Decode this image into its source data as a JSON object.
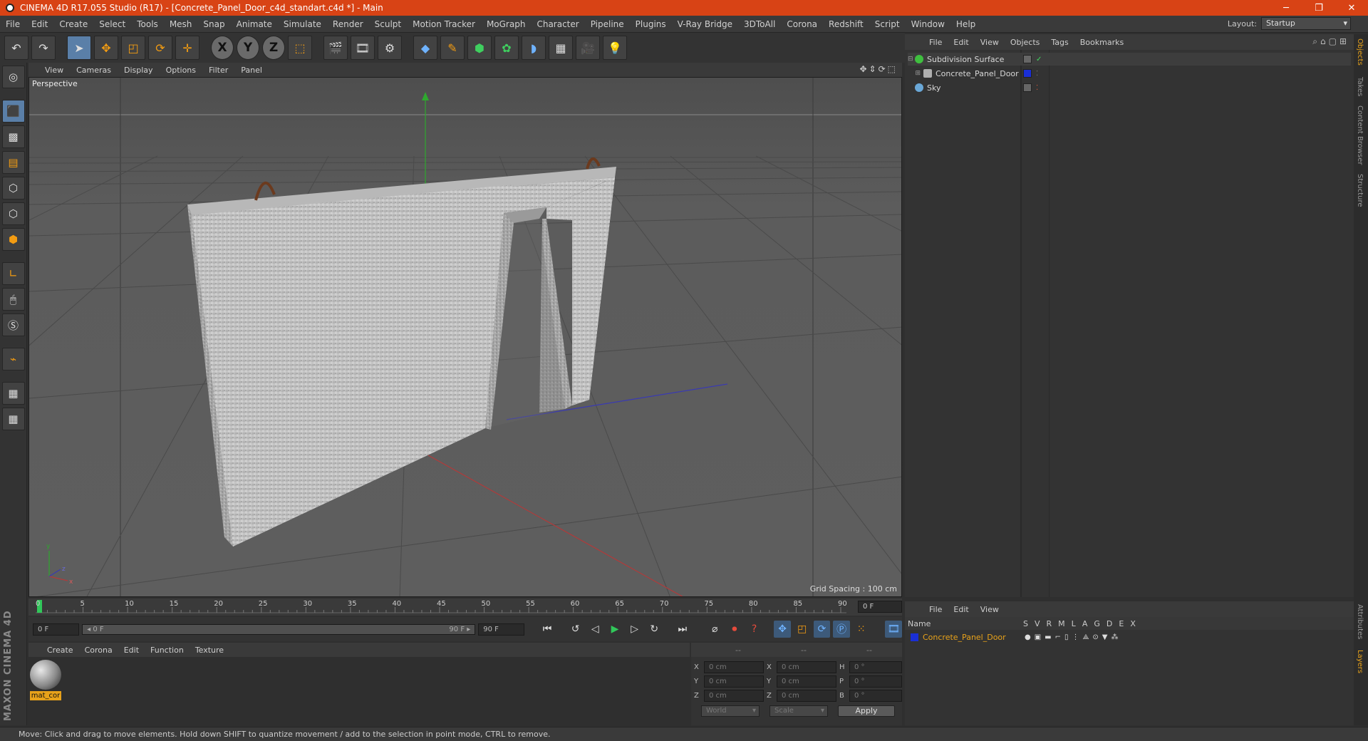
{
  "window": {
    "title": "CINEMA 4D R17.055 Studio (R17) - [Concrete_Panel_Door_c4d_standart.c4d *] - Main",
    "minimize": "─",
    "restore": "❐",
    "close": "✕"
  },
  "menubar": {
    "items": [
      "File",
      "Edit",
      "Create",
      "Select",
      "Tools",
      "Mesh",
      "Snap",
      "Animate",
      "Simulate",
      "Render",
      "Sculpt",
      "Motion Tracker",
      "MoGraph",
      "Character",
      "Pipeline",
      "Plugins",
      "V-Ray Bridge",
      "3DToAll",
      "Corona",
      "Redshift",
      "Script",
      "Window",
      "Help"
    ],
    "layout_label": "Layout:",
    "layout_value": "Startup"
  },
  "axis_buttons": [
    "X",
    "Y",
    "Z"
  ],
  "viewport": {
    "menu": [
      "View",
      "Cameras",
      "Display",
      "Options",
      "Filter",
      "Panel"
    ],
    "name": "Perspective",
    "grid_spacing": "Grid Spacing : 100 cm"
  },
  "timeline": {
    "ticks": [
      "0",
      "5",
      "10",
      "15",
      "20",
      "25",
      "30",
      "35",
      "40",
      "45",
      "50",
      "55",
      "60",
      "65",
      "70",
      "75",
      "80",
      "85",
      "90"
    ],
    "current_frame": "0 F",
    "start_field": "0 F",
    "slider_left": "◂ 0 F",
    "slider_right": "90 F ▸",
    "end_field": "90 F"
  },
  "material_manager": {
    "menu": [
      "Create",
      "Corona",
      "Edit",
      "Function",
      "Texture"
    ],
    "material_name": "mat_cor"
  },
  "coordinates": {
    "headers": [
      "--",
      "--",
      "--"
    ],
    "rows": [
      {
        "a": "X",
        "av": "0 cm",
        "b": "X",
        "bv": "0 cm",
        "c": "H",
        "cv": "0 °"
      },
      {
        "a": "Y",
        "av": "0 cm",
        "b": "Y",
        "bv": "0 cm",
        "c": "P",
        "cv": "0 °"
      },
      {
        "a": "Z",
        "av": "0 cm",
        "b": "Z",
        "bv": "0 cm",
        "c": "B",
        "cv": "0 °"
      }
    ],
    "mode": "World",
    "size_mode": "Scale",
    "apply": "Apply"
  },
  "object_manager": {
    "menu": [
      "File",
      "Edit",
      "View",
      "Objects",
      "Tags",
      "Bookmarks"
    ],
    "objects": [
      {
        "name": "Subdivision Surface",
        "color": "#3fbf3f"
      },
      {
        "name": "Concrete_Panel_Door",
        "color": "#b0b0b0"
      },
      {
        "name": "Sky",
        "color": "#6aa8d8"
      }
    ]
  },
  "attributes_manager": {
    "menu": [
      "File",
      "Edit",
      "View"
    ],
    "name_col": "Name",
    "cols": [
      "S",
      "V",
      "R",
      "M",
      "L",
      "A",
      "G",
      "D",
      "E",
      "X"
    ],
    "layer_name": "Concrete_Panel_Door"
  },
  "side_tabs": [
    "Objects",
    "Takes",
    "Content Browser",
    "Structure",
    "Attributes",
    "Layers"
  ],
  "status": "Move: Click and drag to move elements. Hold down SHIFT to quantize movement / add to the selection in point mode, CTRL to remove.",
  "brand": "MAXON CINEMA 4D"
}
